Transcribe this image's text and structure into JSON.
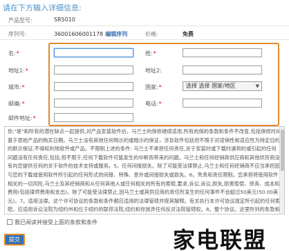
{
  "header": {
    "title": "请在下方输入详细信息:"
  },
  "product": {
    "model_label": "产品型号:",
    "model_value": "SR5010",
    "serial_label": "序列号:",
    "serial_value": "36001606001178",
    "edit_serial_label": "编辑序列",
    "price_label": "价格:",
    "price_value": "免费"
  },
  "form": {
    "name_label": "名:",
    "surname_label": "姓:",
    "address1_label": "地址1:",
    "address2_label": "地址2:",
    "city_label": "城市:",
    "country_label": "国家:",
    "country_selected": "选择 选择 国家/地区",
    "postcode_label": "邮编:",
    "phone_label": "电话:",
    "email_label": "邮件地址:",
    "required_mark": "*"
  },
  "terms": {
    "text": "你,\"是\"和所有的潜在缺点一起提供,对产品安装软件后，马兰士的保修继续适用,所有肉保的条款和条件不改变,包括保修时间基于原始产品的购买日期。马兰士没有其他任何明示的或暗示的保证，涉及软件包括但不限于对适销性和适应性为特定目的的默示保证,不得权利地软件或产品。不限制上述的条件: 马兰士不承担任何责任,关于安装时或下载时遇到的或引起的任何问题没有任何责任,包括,但不限于,任何下载软件可能发生的中断而带来的问题。马兰士和任何经销商供应商和其他供货商没有向您提供任何的关于软件的技术支持或服务。5。任何间接损失。除了可能受法律禁止,马兰士和任何经销商不应当承担因与您的下载或使用软件所引起的任何形式的间接、特殊、意外或间接损失或损失。6。免责和责任限制。您承担将使用软件相关的一切风险,马兰士及其经销商和从任何其他人或任何相关的所有的索赔,要求,诉讼,诉讼,损失,损害赔偿、债务、成本和费用(包括律师费用和支出)。除了可能受法律禁止,因马兰士或其供应商的责任所发生的任何事件不会超过50美元(50.00美元)。7。适用法律。这个许可协议的条款和条件都应适用的法律管辖并按其解释。有关执行本许可协议规定所引起的任何索赔，应适用诉讼法院为纽约州和位于纽约的联邦法院,纽约和你放弃任何反对法院管辖权。8。整个协议。这里所列的条款和条件规定构成您和马兰士之间所有的协议，任何先前的协议，谅解,或口头或书面相关的安排"
  },
  "agree": {
    "label": "我已阅读并接受上面的条款和条件"
  },
  "submit": {
    "label": "提交"
  },
  "watermark": {
    "text": "家电联盟"
  }
}
